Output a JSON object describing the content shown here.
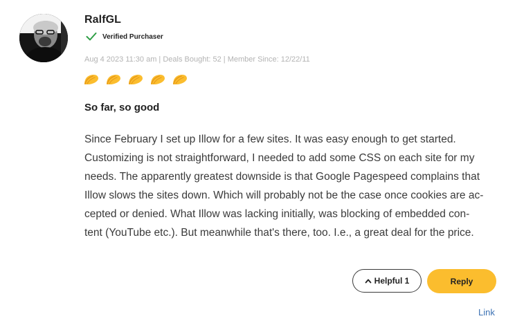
{
  "review": {
    "author": "RalfGL",
    "badge": "Verified Purchaser",
    "meta": "Aug 4 2023 11:30 am | Deals Bought: 52 | Member Since: 12/22/11",
    "rating": 5,
    "rating_icon": "taco-icon",
    "title": "So far, so good",
    "body_lines": [
      "Since February I set up Illow for a few sites. It was easy enough to get started.",
      "Customizing is not straightforward, I needed to add some CSS on each site for my",
      "needs. The apparently greatest downside is that Google Pagespeed complains that",
      "Illow slows the sites down. Which will probably not be the case once cookies are ac-",
      "cepted or denied. What Illow was lacking initially, was blocking of embedded con-",
      "tent (YouTube etc.). But meanwhile that's there, too. I.e., a great deal for the price."
    ]
  },
  "actions": {
    "helpful_label": "Helpful 1",
    "reply_label": "Reply",
    "link_label": "Link"
  },
  "colors": {
    "accent": "#fbbd2e",
    "check": "#2e9e45",
    "link": "#3d72b4",
    "meta": "#b3b3b3"
  }
}
